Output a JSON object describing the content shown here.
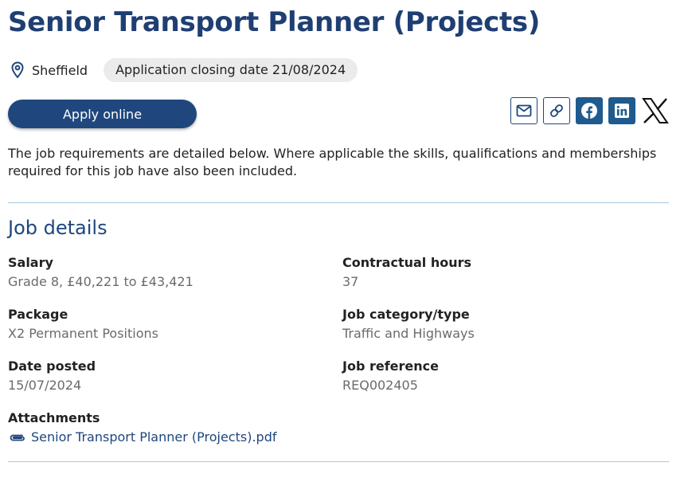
{
  "job": {
    "title": "Senior Transport Planner (Projects)",
    "location": "Sheffield",
    "closing": "Application closing date 21/08/2024"
  },
  "actions": {
    "apply_label": "Apply online"
  },
  "share": {
    "icons": [
      "email-icon",
      "link-icon",
      "facebook-icon",
      "linkedin-icon",
      "x-icon"
    ]
  },
  "intro": "The job requirements are detailed below. Where applicable the skills, qualifications and memberships required for this job have also been included.",
  "details": {
    "heading": "Job details",
    "salary": {
      "label": "Salary",
      "value": "Grade 8, £40,221 to £43,421"
    },
    "hours": {
      "label": "Contractual hours",
      "value": "37"
    },
    "package": {
      "label": "Package",
      "value": "X2 Permanent Positions"
    },
    "category": {
      "label": "Job category/type",
      "value": "Traffic and Highways"
    },
    "posted": {
      "label": "Date posted",
      "value": "15/07/2024"
    },
    "reference": {
      "label": "Job reference",
      "value": "REQ002405"
    },
    "attachments": {
      "label": "Attachments",
      "file": "Senior Transport Planner (Projects).pdf"
    }
  },
  "colors": {
    "brand": "#1f477d",
    "title": "#1f3f73",
    "social_filled": "#1f5b8e",
    "divider": "#a8c8dc",
    "pill_bg": "#ebebeb"
  }
}
